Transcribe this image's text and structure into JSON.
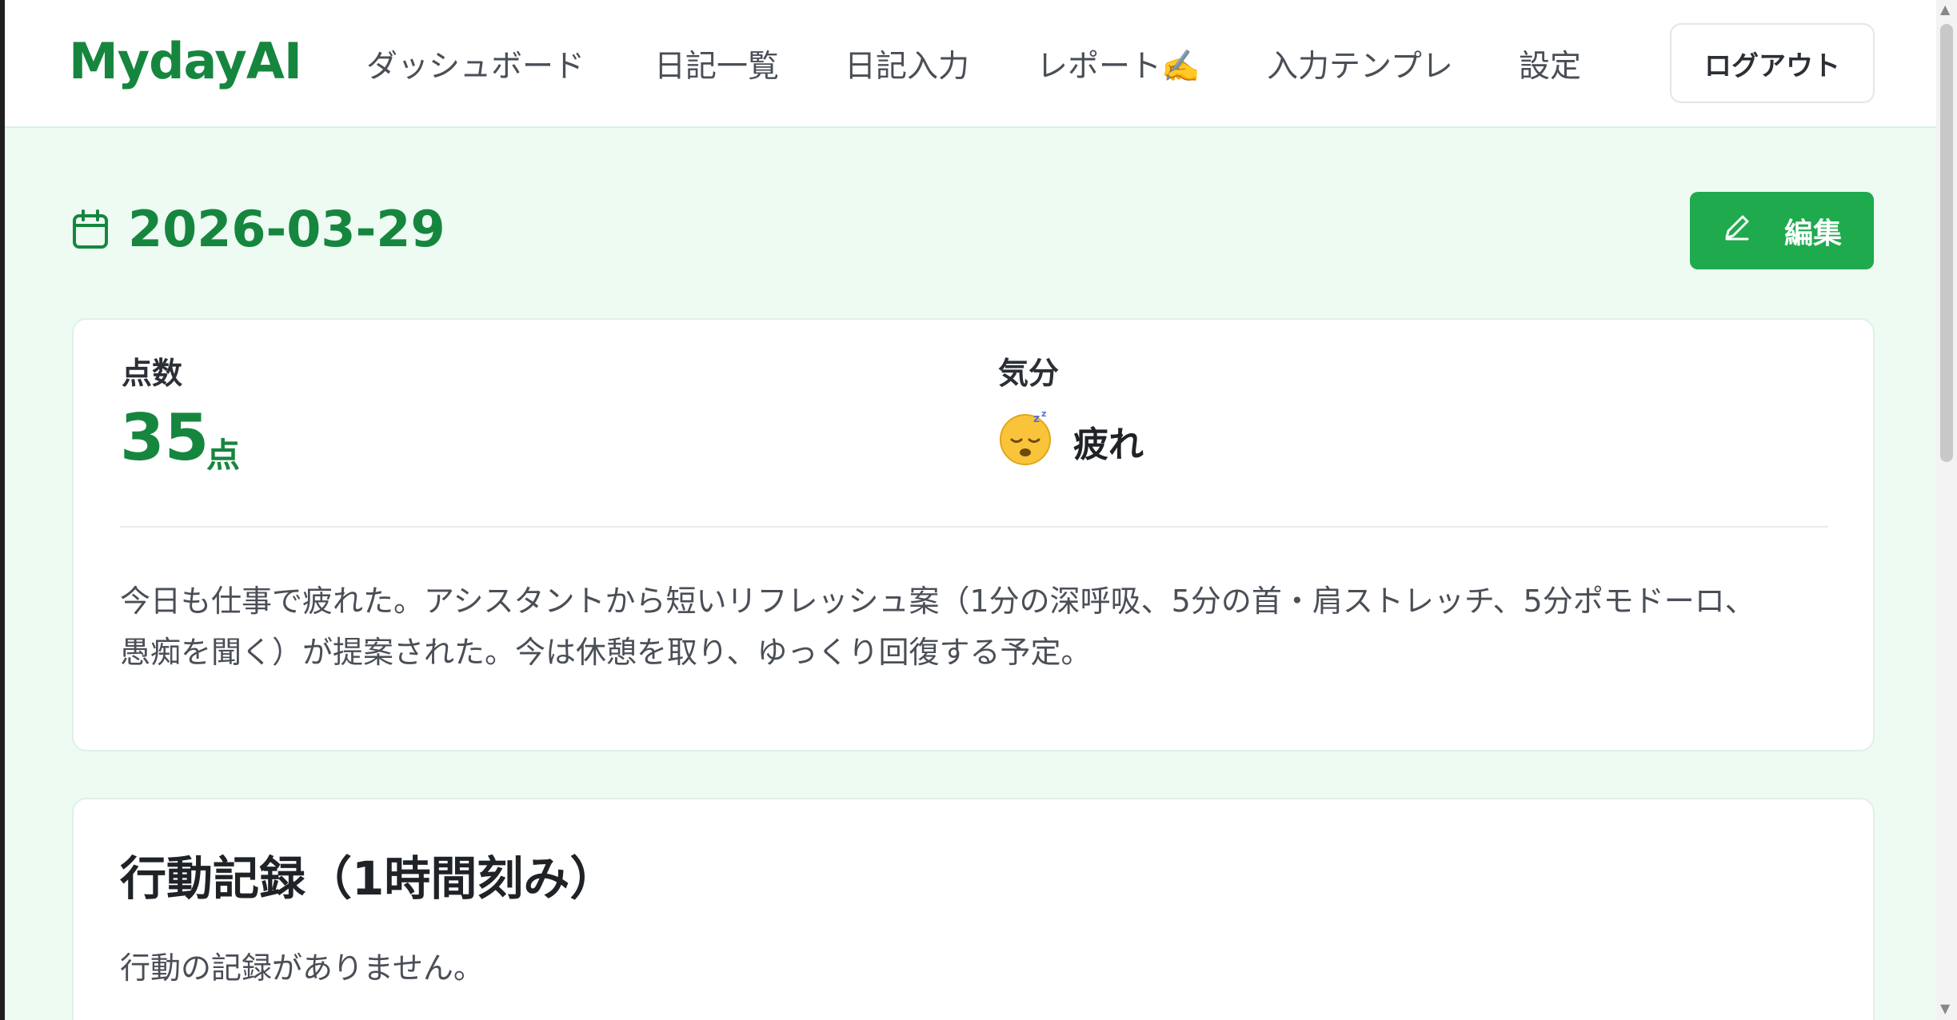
{
  "header": {
    "logo": "MydayAI",
    "nav": [
      {
        "label": "ダッシュボード"
      },
      {
        "label": "日記一覧"
      },
      {
        "label": "日記入力"
      },
      {
        "label": "レポート✍️"
      },
      {
        "label": "入力テンプレ"
      },
      {
        "label": "設定"
      }
    ],
    "logout_label": "ログアウト"
  },
  "entry": {
    "date": "2026-03-29",
    "edit_label": "編集",
    "score_label": "点数",
    "score_value": "35",
    "score_unit": "点",
    "mood_label": "気分",
    "mood_value": "疲れ",
    "mood_icon": "sleepy-face-icon",
    "body_line1": "今日も仕事で疲れた。アシスタントから短いリフレッシュ案（1分の深呼吸、5分の首・肩ストレッチ、5分ポモドーロ、",
    "body_line2": "愚痴を聞く）が提案された。今は休憩を取り、ゆっくり回復する予定。"
  },
  "actions": {
    "title": "行動記録（1時間刻み）",
    "empty": "行動の記録がありません。"
  },
  "colors": {
    "brand": "#16863f",
    "button": "#1eaa4d",
    "background": "#edfbf2"
  }
}
